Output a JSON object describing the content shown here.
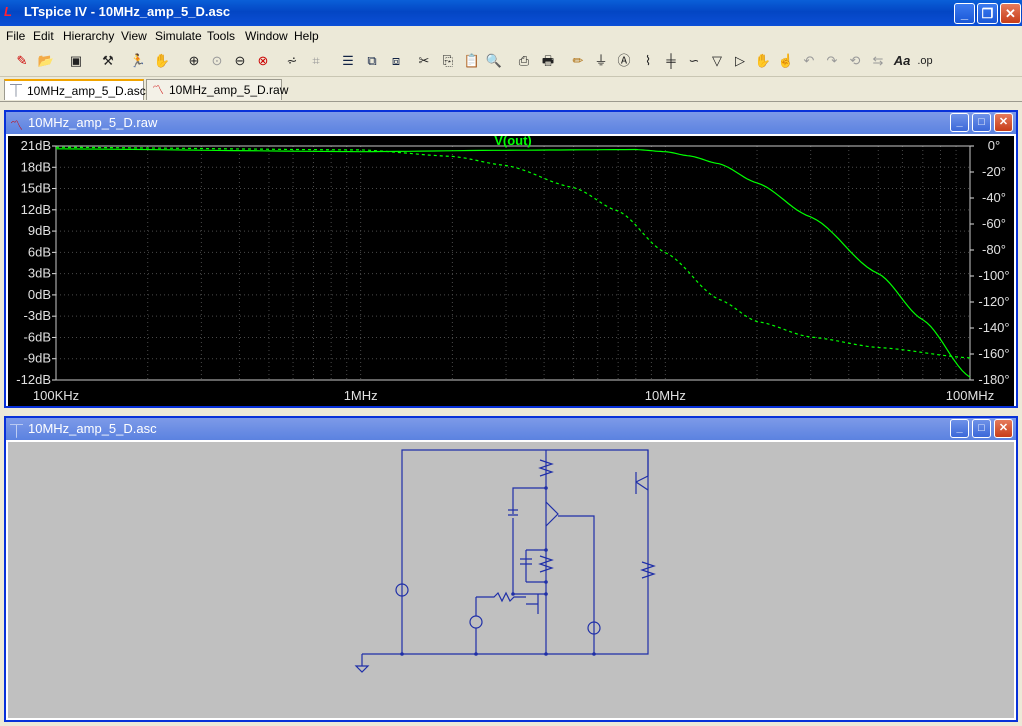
{
  "app": {
    "title": "LTspice IV - 10MHz_amp_5_D.asc"
  },
  "menu": [
    "File",
    "Edit",
    "Hierarchy",
    "View",
    "Simulate",
    "Tools",
    "Window",
    "Help"
  ],
  "tabs": [
    {
      "label": "10MHz_amp_5_D.asc",
      "icon": "schematic-icon"
    },
    {
      "label": "10MHz_amp_5_D.raw",
      "icon": "waveform-icon"
    }
  ],
  "plot_window": {
    "title": "10MHz_amp_5_D.raw"
  },
  "schematic_window": {
    "title": "10MHz_amp_5_D.asc"
  },
  "chart_data": {
    "type": "line",
    "title": "V(out)",
    "x_scale": "log",
    "xlim": [
      100000,
      100000000
    ],
    "x_ticks": [
      "100KHz",
      "1MHz",
      "10MHz",
      "100MHz"
    ],
    "y_left_ticks": [
      "21dB",
      "18dB",
      "15dB",
      "12dB",
      "9dB",
      "6dB",
      "3dB",
      "0dB",
      "-3dB",
      "-6dB",
      "-9dB",
      "-12dB"
    ],
    "y_left_lim": [
      -12,
      21
    ],
    "y_right_ticks": [
      "0°",
      "-20°",
      "-40°",
      "-60°",
      "-80°",
      "-100°",
      "-120°",
      "-140°",
      "-160°",
      "-180°"
    ],
    "y_right_lim": [
      -180,
      0
    ],
    "series": [
      {
        "name": "V(out)",
        "axis": "magnitude",
        "style": "solid",
        "color": "#00ff00",
        "x": [
          100000,
          1000000,
          3000000,
          8000000,
          10000000,
          12000000,
          15000000,
          20000000,
          30000000,
          50000000,
          70000000,
          100000000
        ],
        "values": [
          20.6,
          20.2,
          20.4,
          20.5,
          20.2,
          19.6,
          18.5,
          15.8,
          11.0,
          3.0,
          -3.5,
          -11.6
        ]
      },
      {
        "name": "V(out)",
        "axis": "phase",
        "style": "dashed",
        "color": "#00ff00",
        "x": [
          100000,
          1000000,
          2000000,
          3000000,
          5000000,
          7000000,
          10000000,
          15000000,
          20000000,
          30000000,
          50000000,
          100000000
        ],
        "values": [
          -1,
          -3,
          -8,
          -15,
          -32,
          -50,
          -82,
          -118,
          -135,
          -147,
          -155,
          -163
        ]
      }
    ]
  },
  "colors": {
    "trace": "#00ff00",
    "grid": "#4a4a4a",
    "axis_text": "#e0e0e0",
    "schematic_wire": "#1f2fa8",
    "schematic_bg": "#c0c0c0"
  }
}
